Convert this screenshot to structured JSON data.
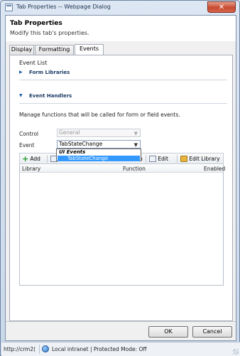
{
  "window": {
    "title": "Tab Properties -- Webpage Dialog",
    "close_label": "✕"
  },
  "header": {
    "title": "Tab Properties",
    "subtitle": "Modify this tab's properties."
  },
  "tabs": [
    {
      "label": "Display",
      "active": false
    },
    {
      "label": "Formatting",
      "active": false
    },
    {
      "label": "Events",
      "active": true
    }
  ],
  "event_list": {
    "title": "Event List",
    "form_libraries": {
      "label": "Form Libraries",
      "expanded": false
    },
    "event_handlers": {
      "label": "Event Handlers",
      "expanded": true
    }
  },
  "handlers": {
    "description": "Manage functions that will be called for form or field events.",
    "control_label": "Control",
    "control_value": "General",
    "event_label": "Event",
    "event_value": "TabStateChange",
    "dropdown": {
      "group_label": "UI Events",
      "options": [
        "TabStateChange"
      ],
      "selected": "TabStateChange"
    }
  },
  "toolbar": {
    "add_label": "Add",
    "properties_label": "n",
    "edit_label": "Edit",
    "edit_library_label": "Edit Library"
  },
  "grid": {
    "columns": [
      "Library",
      "Function",
      "Enabled"
    ],
    "rows": []
  },
  "footer": {
    "ok_label": "OK",
    "cancel_label": "Cancel"
  },
  "statusbar": {
    "url": "http://crm2(",
    "zone": "Local intranet | Protected Mode: Off"
  },
  "colors": {
    "selection": "#3399ff",
    "close_button": "#c74a30",
    "link": "#1b3a64"
  }
}
